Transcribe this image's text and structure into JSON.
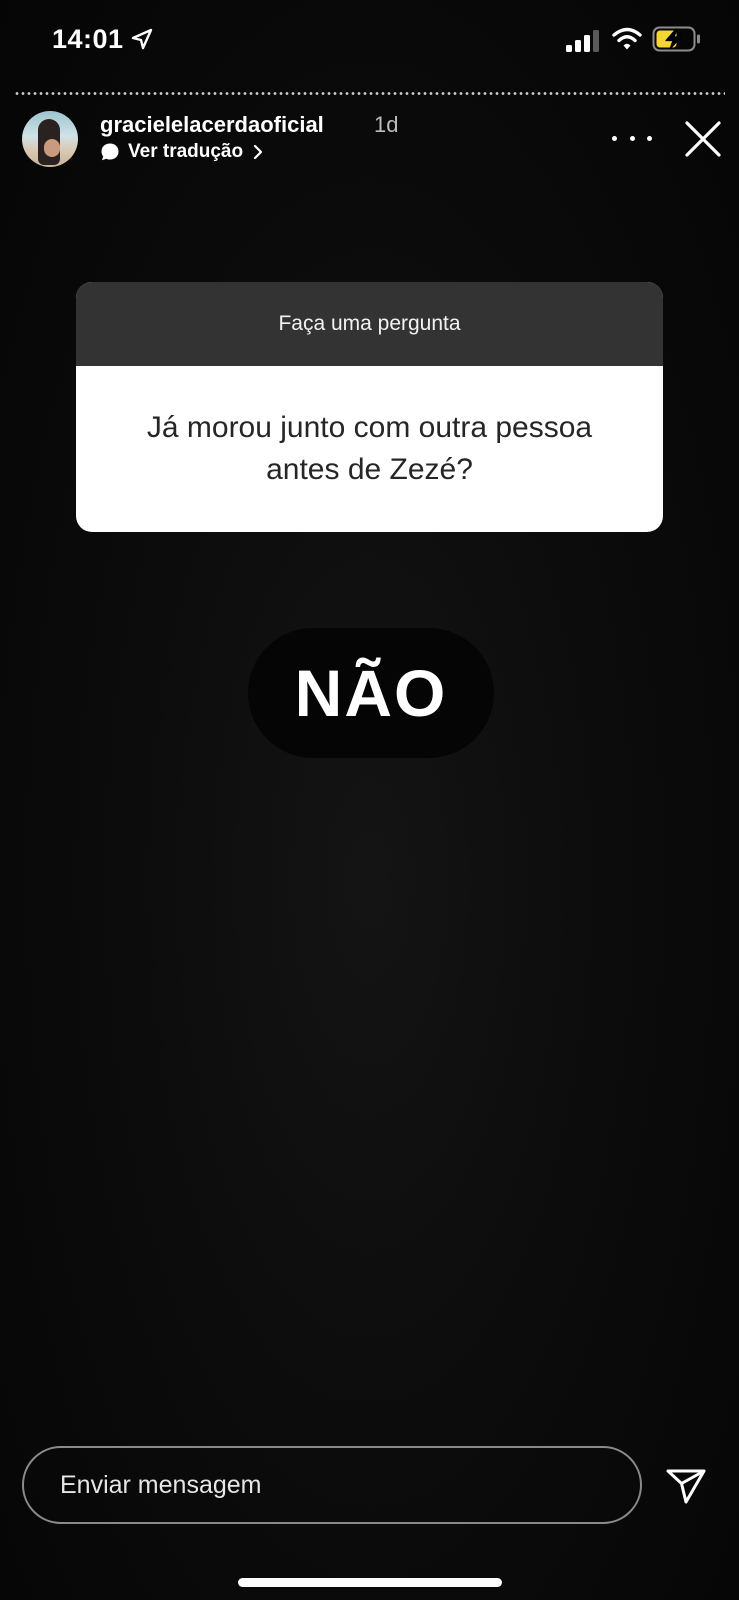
{
  "status_bar": {
    "time": "14:01",
    "icons": [
      "location-arrow-icon",
      "signal-icon",
      "wifi-icon",
      "battery-charging-icon"
    ],
    "battery_color": "#f5d533"
  },
  "story_header": {
    "username": "gracielelacerdaoficial",
    "age": "1d",
    "translate_label": "Ver tradução",
    "icons": [
      "more-icon",
      "close-icon"
    ]
  },
  "question_sticker": {
    "header": "Faça uma pergunta",
    "question": "Já morou junto com outra pessoa\nantes de Zezé?"
  },
  "answer": {
    "text": "NÃO"
  },
  "message_bar": {
    "placeholder": "Enviar mensagem",
    "icon": "send-icon"
  }
}
